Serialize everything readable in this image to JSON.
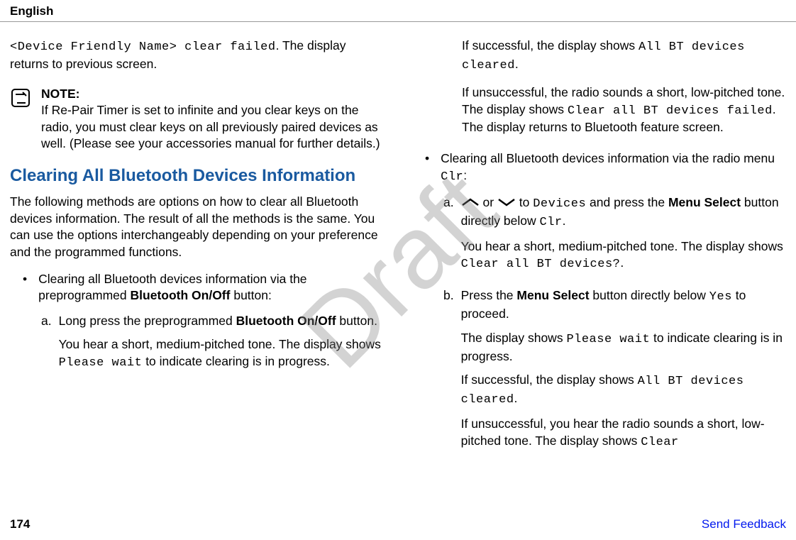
{
  "header": {
    "language": "English"
  },
  "watermark": "Draft",
  "col1": {
    "p1_mono": "<Device Friendly Name> clear failed",
    "p1_after": ". The display returns to previous screen.",
    "note_label": "NOTE:",
    "note_body": "If Re-Pair Timer is set to infinite and you clear keys on the radio, you must clear keys on all previously paired devices as well. (Please see your accessories manual for further details.)",
    "heading": "Clearing All Bluetooth Devices Information",
    "p2": "The following methods are options on how to clear all Bluetooth devices information. The result of all the methods is the same. You can use the options interchangeably depending on your preference and the programmed functions.",
    "bullet1_a": "Clearing all Bluetooth devices information via the preprogrammed ",
    "bullet1_bold": "Bluetooth On/Off",
    "bullet1_b": " button:",
    "step_a_label": "a.",
    "step_a_1a": "Long press the preprogrammed ",
    "step_a_1bold": "Bluetooth On/Off",
    "step_a_1b": " button.",
    "step_a_2a": "You hear a short, medium-pitched tone. The display shows ",
    "step_a_2mono": "Please wait",
    "step_a_2b": " to indicate clearing is in progress."
  },
  "col2": {
    "p1a": "If successful, the display shows ",
    "p1mono": "All BT devices cleared",
    "p1b": ".",
    "p2a": "If unsuccessful, the radio sounds a short, low-pitched tone. The display shows ",
    "p2mono": "Clear all BT devices failed",
    "p2b": ". The display returns to Bluetooth feature screen.",
    "bullet_a": "Clearing all Bluetooth devices information via the radio menu ",
    "bullet_mono": "Clr",
    "bullet_b": ":",
    "step_a_label": "a.",
    "step_a_1a": " or ",
    "step_a_1b": " to ",
    "step_a_1mono": "Devices",
    "step_a_1c": " and press the ",
    "step_a_1bold": "Menu Select",
    "step_a_1d": " button directly below ",
    "step_a_1mono2": "Clr",
    "step_a_1e": ".",
    "step_a_2a": "You hear a short, medium-pitched tone. The display shows ",
    "step_a_2mono": "Clear all BT devices?",
    "step_a_2b": ".",
    "step_b_label": "b.",
    "step_b_1a": "Press the ",
    "step_b_1bold": "Menu Select",
    "step_b_1b": " button directly below ",
    "step_b_1mono": "Yes",
    "step_b_1c": " to proceed.",
    "step_b_2a": "The display shows ",
    "step_b_2mono": "Please wait",
    "step_b_2b": " to indicate clearing is in progress.",
    "step_b_3a": "If successful, the display shows ",
    "step_b_3mono": "All BT devices cleared",
    "step_b_3b": ".",
    "step_b_4a": "If unsuccessful, you hear the radio sounds a short, low-pitched tone. The display shows ",
    "step_b_4mono": "Clear"
  },
  "footer": {
    "page": "174",
    "feedback": "Send Feedback"
  }
}
